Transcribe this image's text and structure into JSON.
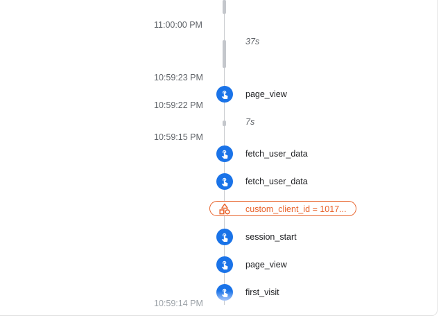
{
  "timeline": {
    "timestamps": [
      {
        "label": "11:00:00 PM"
      },
      {
        "label": "10:59:23 PM"
      },
      {
        "label": "10:59:22 PM"
      },
      {
        "label": "10:59:15 PM"
      },
      {
        "label": "10:59:14 PM"
      }
    ],
    "durations": [
      {
        "label": "37s"
      },
      {
        "label": "7s"
      }
    ],
    "events": [
      {
        "label": "page_view",
        "icon": "touch-icon",
        "type": "event"
      },
      {
        "label": "fetch_user_data",
        "icon": "touch-icon",
        "type": "event"
      },
      {
        "label": "fetch_user_data",
        "icon": "touch-icon",
        "type": "event"
      },
      {
        "label": "custom_client_id = 1017...",
        "icon": "shapes-icon",
        "type": "user-property"
      },
      {
        "label": "session_start",
        "icon": "touch-icon",
        "type": "event"
      },
      {
        "label": "page_view",
        "icon": "touch-icon",
        "type": "event"
      },
      {
        "label": "first_visit",
        "icon": "touch-icon",
        "type": "event"
      }
    ]
  },
  "colors": {
    "event_icon": "#1a73e8",
    "user_property": "#e8622a",
    "axis": "#c9cbcf",
    "muted_text": "#5f6368"
  }
}
